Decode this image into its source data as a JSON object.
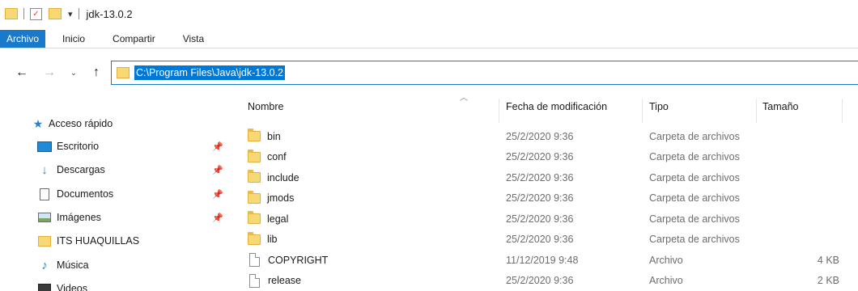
{
  "window": {
    "title": "jdk-13.0.2"
  },
  "ribbon": {
    "tabs": [
      "Archivo",
      "Inicio",
      "Compartir",
      "Vista"
    ]
  },
  "address": {
    "path": "C:\\Program Files\\Java\\jdk-13.0.2"
  },
  "sidebar": {
    "items": [
      {
        "label": "Acceso rápido",
        "icon": "star-icon",
        "pinned": false
      },
      {
        "label": "Escritorio",
        "icon": "desktop-icon",
        "pinned": true
      },
      {
        "label": "Descargas",
        "icon": "download-icon",
        "pinned": true
      },
      {
        "label": "Documentos",
        "icon": "documents-icon",
        "pinned": true
      },
      {
        "label": "Imágenes",
        "icon": "pictures-icon",
        "pinned": true
      },
      {
        "label": "ITS HUAQUILLAS",
        "icon": "folder-icon",
        "pinned": false
      },
      {
        "label": "Música",
        "icon": "music-icon",
        "pinned": false
      },
      {
        "label": "Videos",
        "icon": "videos-icon",
        "pinned": false
      }
    ]
  },
  "columns": {
    "name": "Nombre",
    "date": "Fecha de modificación",
    "type": "Tipo",
    "size": "Tamaño"
  },
  "files": [
    {
      "name": "bin",
      "date": "25/2/2020 9:36",
      "type": "Carpeta de archivos",
      "size": "",
      "kind": "folder"
    },
    {
      "name": "conf",
      "date": "25/2/2020 9:36",
      "type": "Carpeta de archivos",
      "size": "",
      "kind": "folder"
    },
    {
      "name": "include",
      "date": "25/2/2020 9:36",
      "type": "Carpeta de archivos",
      "size": "",
      "kind": "folder"
    },
    {
      "name": "jmods",
      "date": "25/2/2020 9:36",
      "type": "Carpeta de archivos",
      "size": "",
      "kind": "folder"
    },
    {
      "name": "legal",
      "date": "25/2/2020 9:36",
      "type": "Carpeta de archivos",
      "size": "",
      "kind": "folder"
    },
    {
      "name": "lib",
      "date": "25/2/2020 9:36",
      "type": "Carpeta de archivos",
      "size": "",
      "kind": "folder"
    },
    {
      "name": "COPYRIGHT",
      "date": "11/12/2019 9:48",
      "type": "Archivo",
      "size": "4 KB",
      "kind": "file"
    },
    {
      "name": "release",
      "date": "25/2/2020 9:36",
      "type": "Archivo",
      "size": "2 KB",
      "kind": "file"
    }
  ],
  "colors": {
    "accent": "#1979ca",
    "selection": "#0078d7",
    "folder": "#f8d775"
  }
}
